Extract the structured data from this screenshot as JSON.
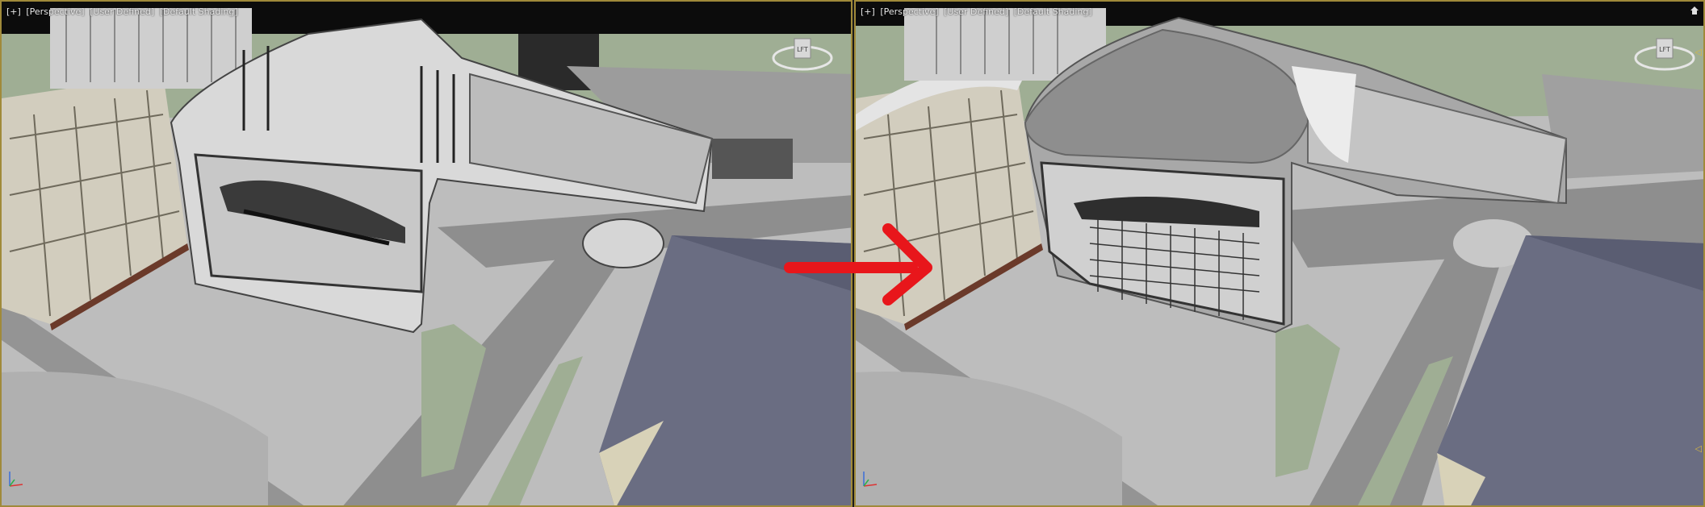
{
  "viewports": [
    {
      "id": "before",
      "labels": [
        "[+]",
        "[Perspective]",
        "[User Defined]",
        "[Default Shading]"
      ]
    },
    {
      "id": "after",
      "labels": [
        "[+]",
        "[Perspective]",
        "[User Defined]",
        "[Default Shading]"
      ]
    }
  ],
  "viewcube_label": "LFT",
  "axis_labels": {
    "x": "x",
    "y": "y",
    "z": "z"
  },
  "colors": {
    "viewport_border": "#a08a3a",
    "annotation_arrow": "#e8161b",
    "ground": "#b9b9b9",
    "road": "#8a8a8a",
    "grass": "#9fae94",
    "roof": "#6a6d82"
  }
}
